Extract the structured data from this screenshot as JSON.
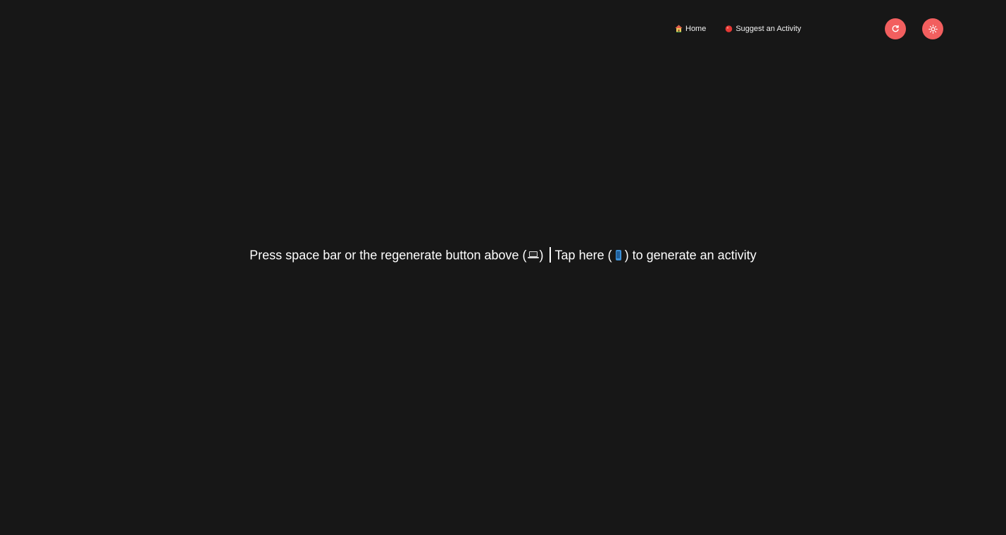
{
  "nav": {
    "home": {
      "icon": "house-icon",
      "label": "Home"
    },
    "suggest": {
      "icon": "red-circle-icon",
      "label": "Suggest an Activity"
    }
  },
  "buttons": {
    "regenerate": {
      "icon": "refresh-icon",
      "color": "#f25f5f"
    },
    "theme": {
      "icon": "sun-icon",
      "color": "#f25f5f"
    }
  },
  "main": {
    "part1": "Press space bar or the regenerate button above (",
    "laptop_icon": "laptop-icon",
    "part2": ")",
    "part3": "Tap here (",
    "phone_icon": "mobile-phone-icon",
    "part4": ") to generate an activity"
  },
  "colors": {
    "background": "#171717",
    "accent": "#f25f5f",
    "text": "#ffffff"
  }
}
